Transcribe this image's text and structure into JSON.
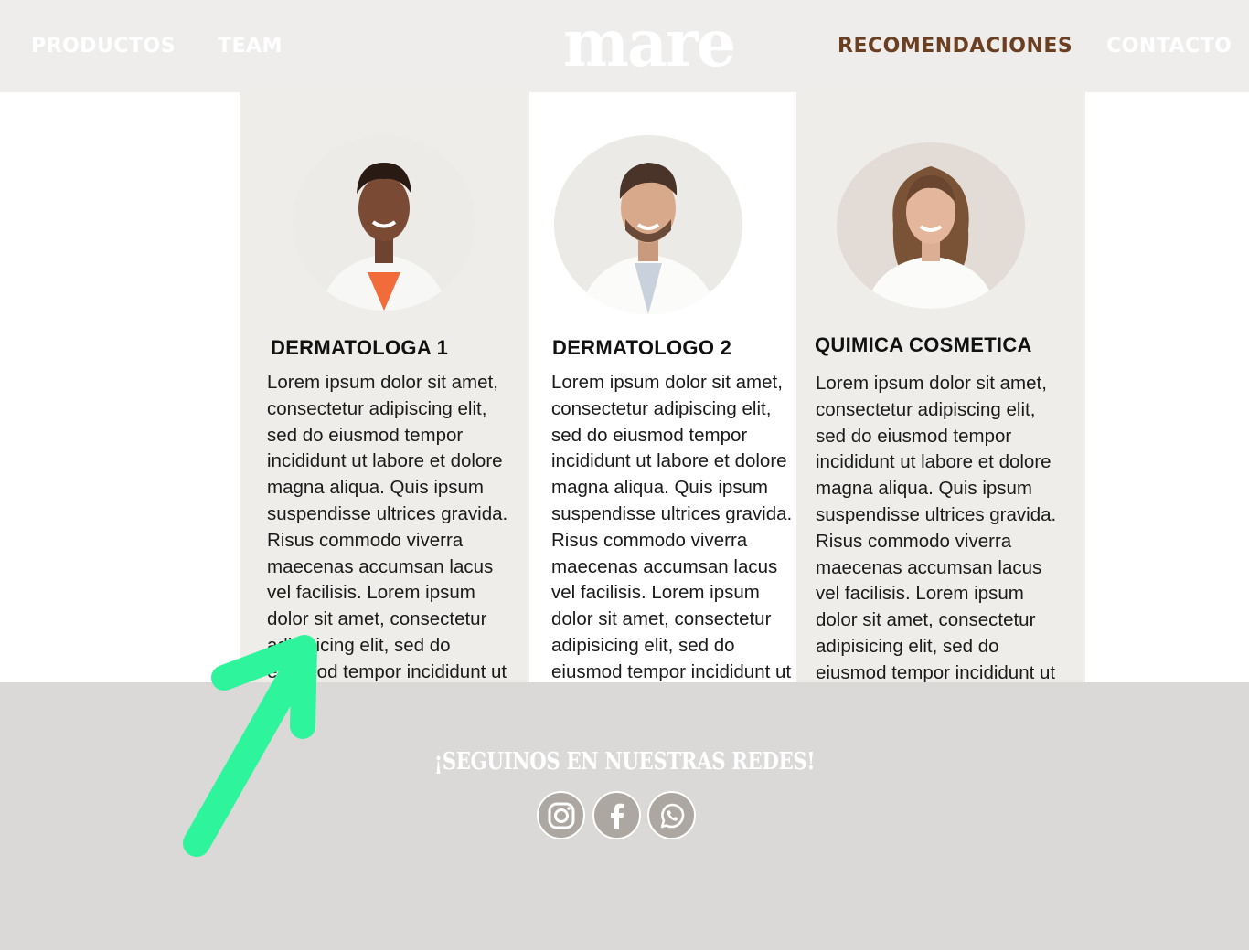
{
  "header": {
    "logo": "mare",
    "nav": {
      "productos": "PRODUCTOS",
      "team": "TEAM",
      "recomendaciones": "RECOMENDACIONES",
      "contacto": "CONTACTO"
    },
    "active_color": "#6b3f22"
  },
  "cards": [
    {
      "title": "DERMATOLOGA 1",
      "text": "Lorem ipsum dolor sit amet, consectetur adipiscing elit, sed do eiusmod tempor incididunt ut labore et dolore magna aliqua. Quis ipsum suspendisse ultrices gravida. Risus commodo viverra maecenas accumsan lacus vel facilisis. Lorem ipsum dolor sit amet, consectetur adipisicing elit, sed do eiusmod tempor incididunt ut"
    },
    {
      "title": "DERMATOLOGO 2",
      "text": "Lorem ipsum dolor sit amet, consectetur adipiscing elit, sed do eiusmod tempor incididunt ut labore et dolore magna aliqua. Quis ipsum suspendisse ultrices gravida. Risus commodo viverra maecenas accumsan lacus vel facilisis. Lorem ipsum dolor sit amet, consectetur adipisicing elit, sed do eiusmod tempor incididunt ut"
    },
    {
      "title": "QUIMICA COSMETICA",
      "text": "Lorem ipsum dolor sit amet, consectetur adipiscing elit, sed do eiusmod tempor incididunt ut labore et dolore magna aliqua. Quis ipsum suspendisse ultrices gravida. Risus commodo viverra maecenas accumsan lacus vel facilisis. Lorem ipsum dolor sit amet, consectetur adipisicing elit, sed do eiusmod tempor incididunt ut"
    }
  ],
  "footer": {
    "follow_text": "¡SEGUINOS EN NUESTRAS REDES!",
    "social": [
      "instagram-icon",
      "facebook-icon",
      "whatsapp-icon"
    ]
  },
  "colors": {
    "header_bg": "#eeedeb",
    "footer_bg": "#dad9d7",
    "social_bg": "#aca7a1",
    "annotation_arrow": "#2ef59c"
  }
}
